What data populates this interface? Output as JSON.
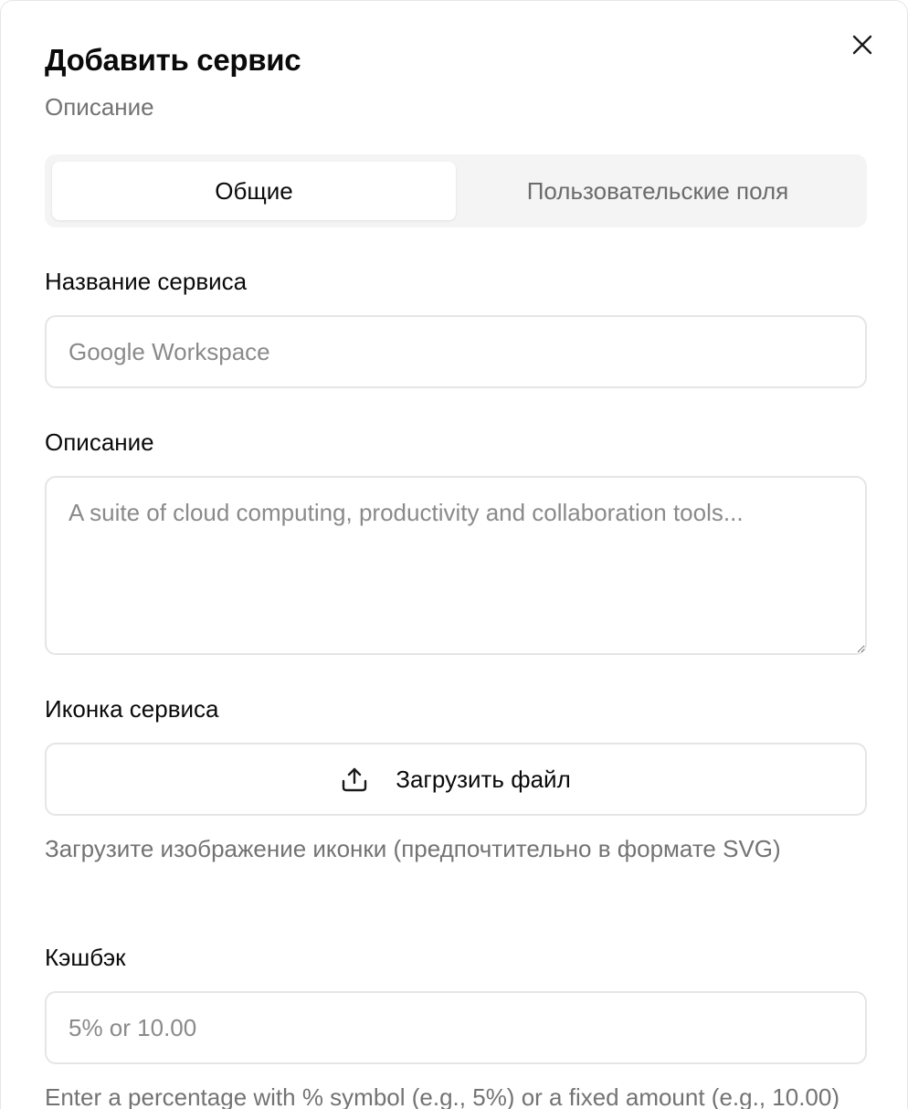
{
  "dialog": {
    "title": "Добавить сервис",
    "description": "Описание",
    "close_icon": "close-icon"
  },
  "tabs": [
    {
      "label": "Общие",
      "active": true
    },
    {
      "label": "Пользовательские поля",
      "active": false
    }
  ],
  "form": {
    "service_name": {
      "label": "Название сервиса",
      "placeholder": "Google Workspace",
      "value": ""
    },
    "description": {
      "label": "Описание",
      "placeholder": "A suite of cloud computing, productivity and collaboration tools...",
      "value": ""
    },
    "icon": {
      "label": "Иконка сервиса",
      "upload_label": "Загрузить файл",
      "upload_icon": "upload-icon",
      "help": "Загрузите изображение иконки (предпочтительно в формате SVG)"
    },
    "cashback": {
      "label": "Кэшбэк",
      "placeholder": "5% or 10.00",
      "value": "",
      "help": "Enter a percentage with % symbol (e.g., 5%) or a fixed amount (e.g., 10.00)"
    }
  },
  "colors": {
    "text": "#0a0a0a",
    "muted": "#737373",
    "border": "#e5e5e5",
    "tabs_bg": "#f4f4f4"
  }
}
